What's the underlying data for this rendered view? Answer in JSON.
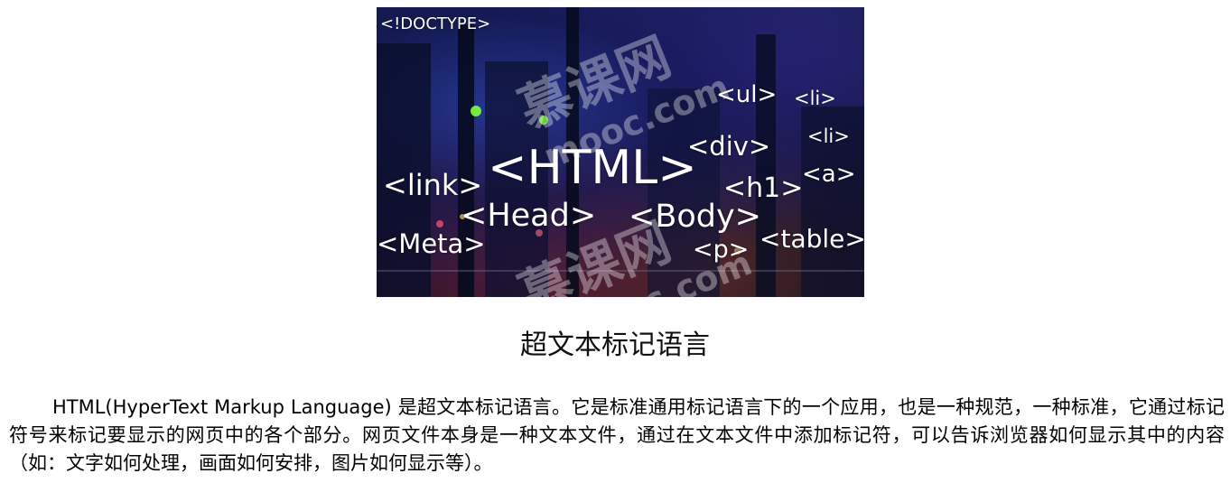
{
  "image": {
    "tags": [
      "<!DOCTYPE>",
      "<ul>",
      "<li>",
      "<li>",
      "<div>",
      "<HTML>",
      "<link>",
      "<h1>",
      "<a>",
      "<Head>",
      "<Body>",
      "<Meta>",
      "<p>",
      "<table>"
    ],
    "watermark": {
      "brand": "慕课网",
      "domain": "mooc.com"
    }
  },
  "heading": "超文本标记语言",
  "paragraph": "HTML(HyperText Markup Language) 是超文本标记语言。它是标准通用标记语言下的一个应用，也是一种规范，一种标准，它通过标记符号来标记要显示的网页中的各个部分。网页文件本身是一种文本文件，通过在文本文件中添加标记符，可以告诉浏览器如何显示其中的内容（如：文字如何处理，画面如何安排，图片如何显示等）。"
}
